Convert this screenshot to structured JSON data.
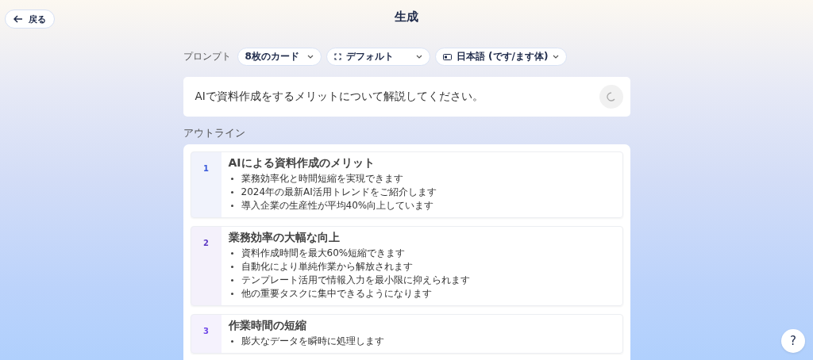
{
  "header": {
    "back_button": "戻る",
    "title": "生成"
  },
  "prompt": {
    "label": "プロンプト",
    "options": [
      {
        "kind": "cards",
        "label": "8枚のカード"
      },
      {
        "kind": "layout",
        "label": "デフォルト"
      },
      {
        "kind": "language",
        "label": "日本語 (です/ます体)"
      }
    ],
    "value": "AIで資料作成をするメリットについて解説してください。",
    "loading": true
  },
  "outline": {
    "label": "アウトライン",
    "sections": [
      {
        "number": "1",
        "color": "#3b5bdb",
        "title": "AIによる資料作成のメリット",
        "bullets": [
          "業務効率化と時間短縮を実現できます",
          "2024年の最新AI活用トレンドをご紹介します",
          "導入企業の生産性が平均40%向上しています"
        ]
      },
      {
        "number": "2",
        "color": "#5f3dc4",
        "title": "業務効率の大幅な向上",
        "bullets": [
          "資料作成時間を最大60%短縮できます",
          "自動化により単純作業から解放されます",
          "テンプレート活用で情報入力を最小限に抑えられます",
          "他の重要タスクに集中できるようになります"
        ]
      },
      {
        "number": "3",
        "color": "#7048e8",
        "title": "作業時間の短縮",
        "bullets": [
          "膨大なデータを瞬時に処理します"
        ]
      }
    ]
  },
  "help_button": "?"
}
